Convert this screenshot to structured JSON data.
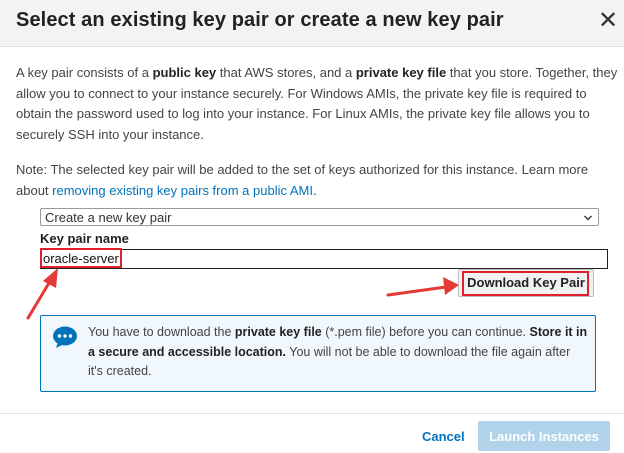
{
  "dialog": {
    "title": "Select an existing key pair or create a new key pair",
    "close_label": "✕"
  },
  "description": {
    "t1": "A key pair consists of a ",
    "b1": "public key",
    "t2": " that AWS stores, and a ",
    "b2": "private key file",
    "t3": " that you store. Together, they allow you to connect to your instance securely. For Windows AMIs, the private key file is required to obtain the password used to log into your instance. For Linux AMIs, the private key file allows you to securely SSH into your instance."
  },
  "note": {
    "text": "Note: The selected key pair will be added to the set of keys authorized for this instance. Learn more about ",
    "link": "removing existing key pairs from a public AMI",
    "end": "."
  },
  "key_pair": {
    "select_value": "Create a new key pair",
    "name_label": "Key pair name",
    "name_value": "oracle-server",
    "download_label": "Download Key Pair"
  },
  "info": {
    "t1": "You have to download the ",
    "b1": "private key file",
    "t2": " (*.pem file) before you can continue. ",
    "b2": "Store it in a secure and accessible location.",
    "t3": " You will not be able to download the file again after it's created."
  },
  "footer": {
    "cancel_label": "Cancel",
    "launch_label": "Launch Instances"
  },
  "colors": {
    "link": "#0073bb",
    "highlight": "#e0202a",
    "info_bg": "#f1f8fd",
    "launch_disabled": "#b0d3ea"
  },
  "icons": {
    "info": "chat-bubble-icon",
    "caret": "chevron-down-icon",
    "close": "close-icon"
  }
}
